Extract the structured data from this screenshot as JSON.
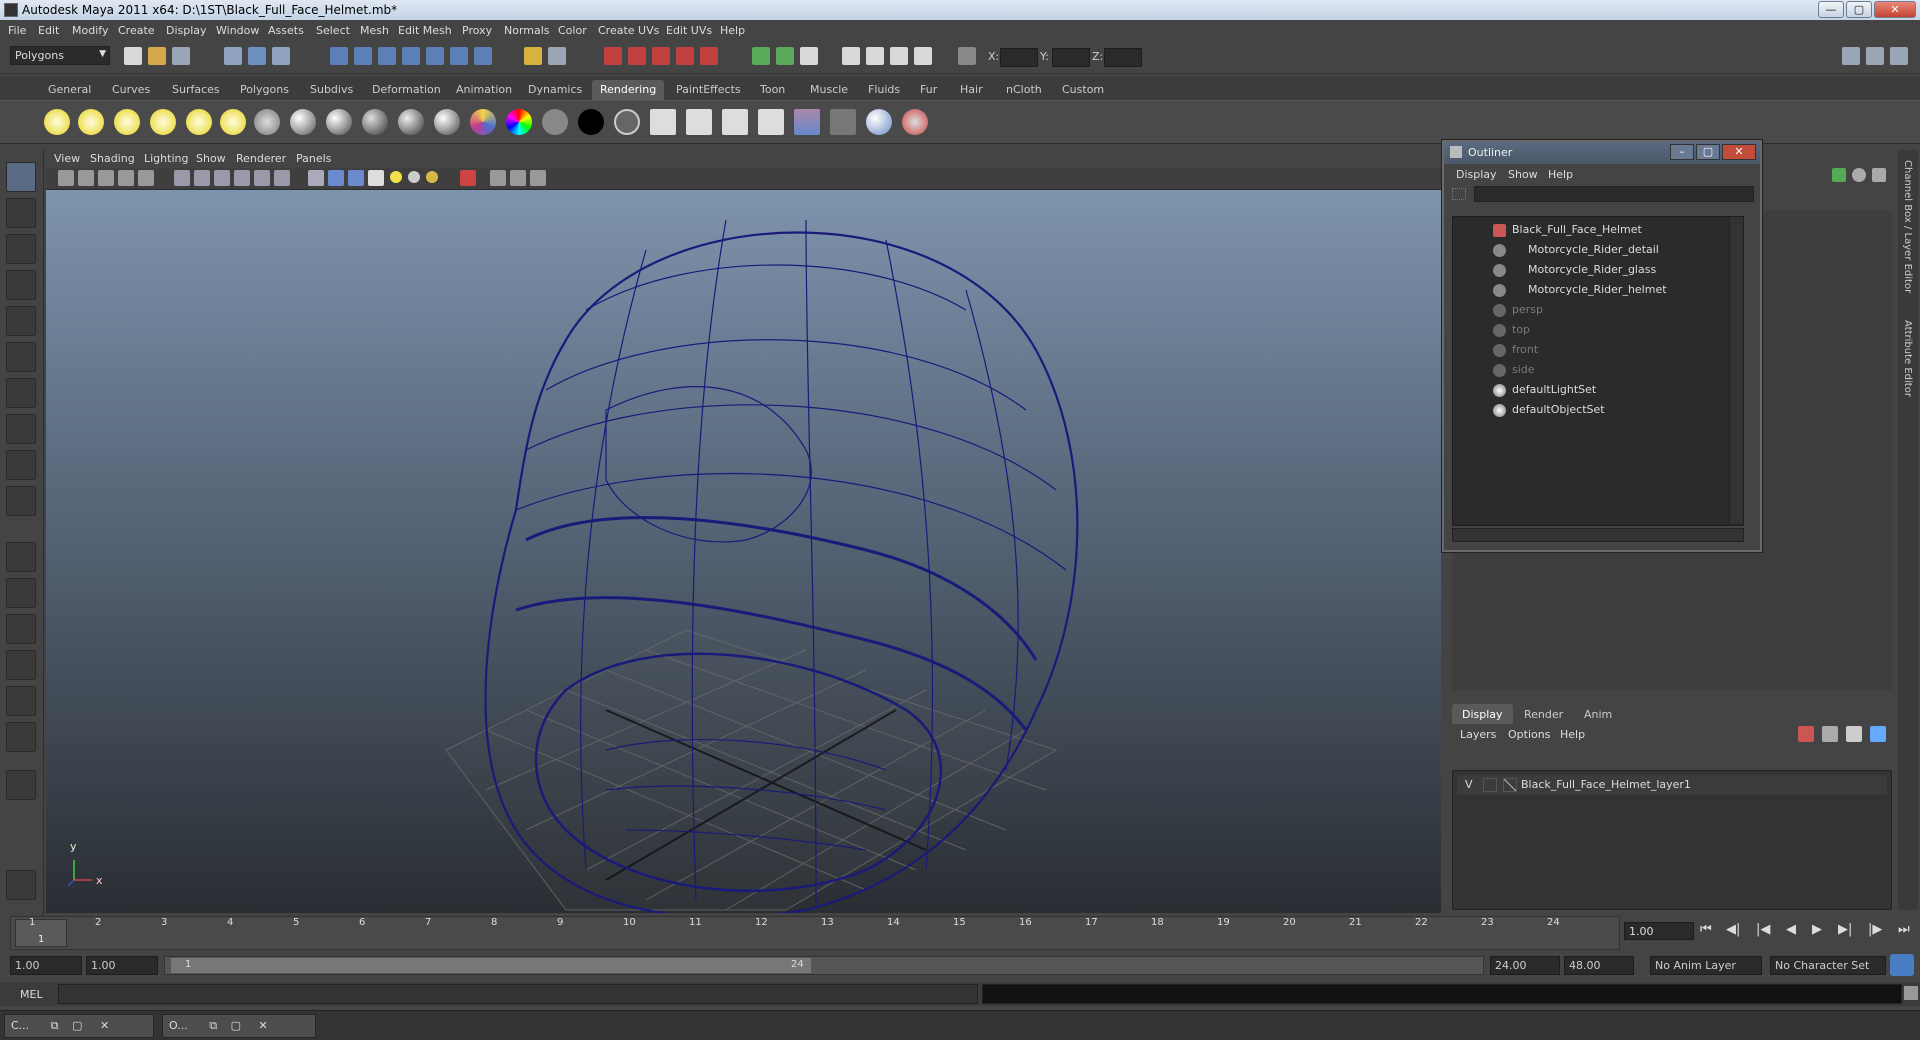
{
  "window": {
    "title": "Autodesk Maya 2011 x64: D:\\1ST\\Black_Full_Face_Helmet.mb*",
    "minimize": "—",
    "maximize": "▢",
    "close": "✕"
  },
  "menubar": [
    "File",
    "Edit",
    "Modify",
    "Create",
    "Display",
    "Window",
    "Assets",
    "Select",
    "Mesh",
    "Edit Mesh",
    "Proxy",
    "Normals",
    "Color",
    "Create UVs",
    "Edit UVs",
    "Help"
  ],
  "statusline": {
    "mode": "Polygons",
    "x_label": "X:",
    "y_label": "Y:",
    "z_label": "Z:"
  },
  "shelf_tabs": {
    "items": [
      "General",
      "Curves",
      "Surfaces",
      "Polygons",
      "Subdivs",
      "Deformation",
      "Animation",
      "Dynamics",
      "Rendering",
      "PaintEffects",
      "Toon",
      "Muscle",
      "Fluids",
      "Fur",
      "Hair",
      "nCloth",
      "Custom"
    ],
    "active": "Rendering"
  },
  "viewport": {
    "menu": [
      "View",
      "Shading",
      "Lighting",
      "Show",
      "Renderer",
      "Panels"
    ],
    "axis_y": "y",
    "axis_x": "x",
    "wire_color": "#1a1a7a"
  },
  "outliner": {
    "title": "Outliner",
    "menu": [
      "Display",
      "Show",
      "Help"
    ],
    "rows": [
      {
        "label": "Black_Full_Face_Helmet",
        "indent": 0,
        "dim": false
      },
      {
        "label": "Motorcycle_Rider_detail",
        "indent": 1,
        "dim": false
      },
      {
        "label": "Motorcycle_Rider_glass",
        "indent": 1,
        "dim": false
      },
      {
        "label": "Motorcycle_Rider_helmet",
        "indent": 1,
        "dim": false
      },
      {
        "label": "persp",
        "indent": 0,
        "dim": true
      },
      {
        "label": "top",
        "indent": 0,
        "dim": true
      },
      {
        "label": "front",
        "indent": 0,
        "dim": true
      },
      {
        "label": "side",
        "indent": 0,
        "dim": true
      },
      {
        "label": "defaultLightSet",
        "indent": 0,
        "dim": false
      },
      {
        "label": "defaultObjectSet",
        "indent": 0,
        "dim": false
      }
    ]
  },
  "layer_editor": {
    "tabs": [
      "Display",
      "Render",
      "Anim"
    ],
    "active": "Display",
    "menu": [
      "Layers",
      "Options",
      "Help"
    ],
    "layer_visible": "V",
    "layer_name": "Black_Full_Face_Helmet_layer1"
  },
  "side_tabs": [
    "Channel Box / Layer Editor",
    "Attribute Editor"
  ],
  "time_slider": {
    "ticks": [
      "1",
      "2",
      "3",
      "4",
      "5",
      "6",
      "7",
      "8",
      "9",
      "10",
      "11",
      "12",
      "13",
      "14",
      "15",
      "16",
      "17",
      "18",
      "19",
      "20",
      "21",
      "22",
      "23",
      "24"
    ],
    "current_frame_marker": "1",
    "current_time": "1.00"
  },
  "range": {
    "start_time": "1.00",
    "playback_start": "1.00",
    "range_start": "1",
    "range_end": "24",
    "playback_end": "24.00",
    "end_time": "48.00",
    "anim_layer": "No Anim Layer",
    "character_set": "No Character Set"
  },
  "cmdline": {
    "label": "MEL"
  },
  "taskbar": [
    {
      "label": "C..."
    },
    {
      "label": "O..."
    }
  ]
}
